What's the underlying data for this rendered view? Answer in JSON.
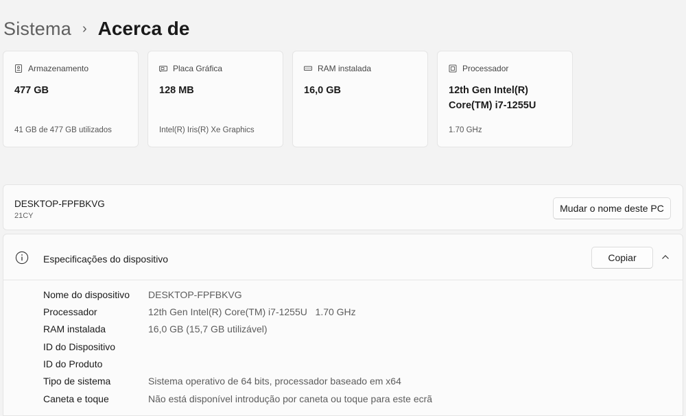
{
  "breadcrumb": {
    "parent": "Sistema",
    "separator": "›",
    "current": "Acerca de"
  },
  "cards": [
    {
      "icon": "storage-icon",
      "label": "Armazenamento",
      "value": "477 GB",
      "sub": "41 GB de 477 GB utilizados"
    },
    {
      "icon": "graphics-card-icon",
      "label": "Placa Gráfica",
      "value": "128 MB",
      "sub": "Intel(R) Iris(R) Xe Graphics"
    },
    {
      "icon": "ram-icon",
      "label": "RAM instalada",
      "value": "16,0 GB",
      "sub": ""
    },
    {
      "icon": "processor-icon",
      "label": "Processador",
      "value": "12th Gen Intel(R) Core(TM) i7-1255U",
      "sub": "1.70 GHz"
    }
  ],
  "device": {
    "name": "DESKTOP-FPFBKVG",
    "model": "21CY",
    "rename_label": "Mudar o nome deste PC"
  },
  "specs": {
    "title": "Especificações do dispositivo",
    "copy_label": "Copiar",
    "rows": [
      {
        "key": "Nome do dispositivo",
        "value": "DESKTOP-FPFBKVG"
      },
      {
        "key": "Processador",
        "value": "12th Gen Intel(R) Core(TM) i7-1255U   1.70 GHz"
      },
      {
        "key": "RAM instalada",
        "value": "16,0 GB (15,7 GB utilizável)"
      },
      {
        "key": "ID do Dispositivo",
        "value": ""
      },
      {
        "key": "ID do Produto",
        "value": ""
      },
      {
        "key": "Tipo de sistema",
        "value": "Sistema operativo de 64 bits, processador baseado em x64"
      },
      {
        "key": "Caneta e toque",
        "value": "Não está disponível introdução por caneta ou toque para este ecrã"
      }
    ]
  }
}
